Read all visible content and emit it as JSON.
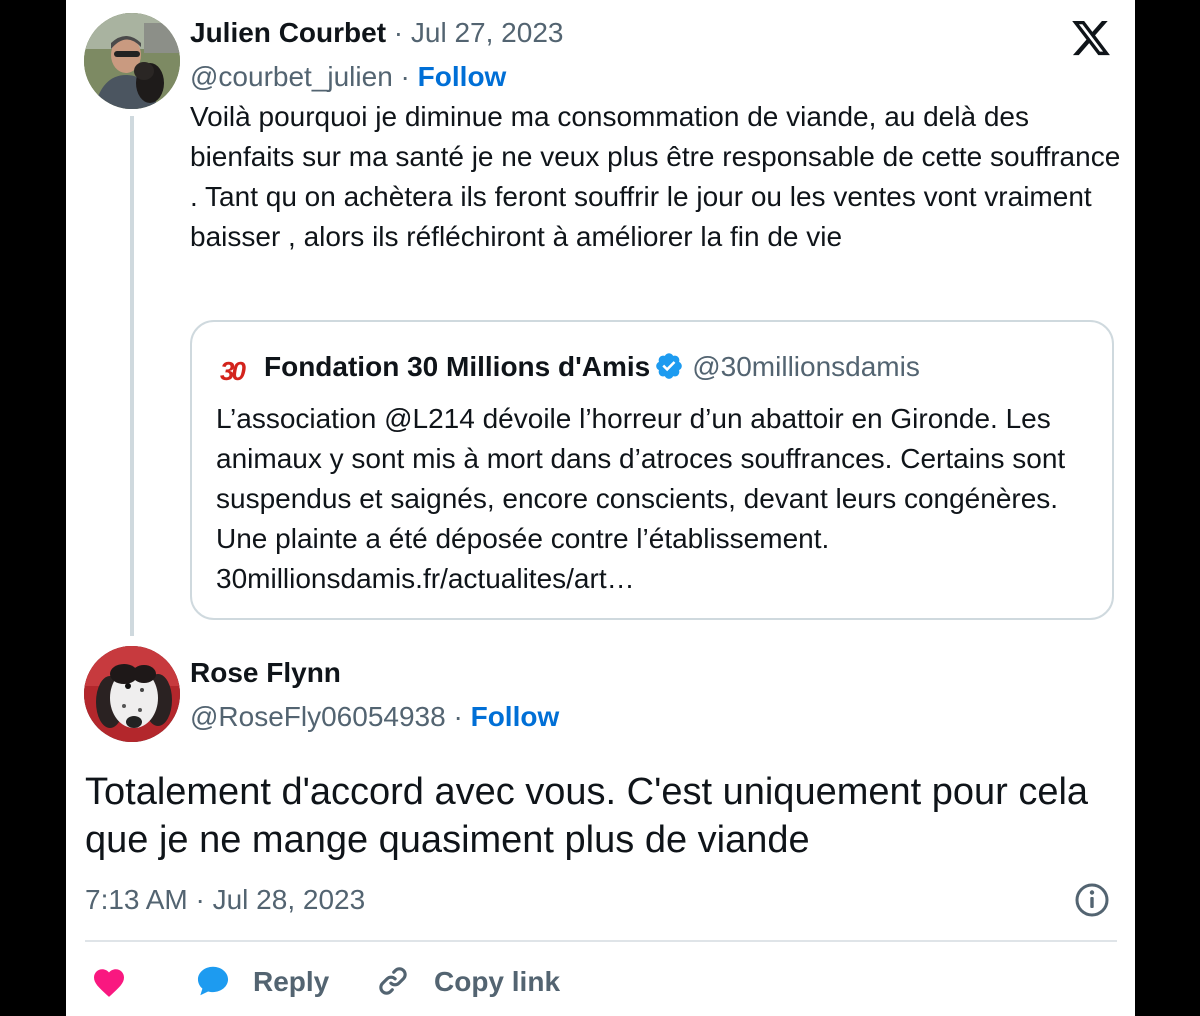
{
  "parent": {
    "author_name": "Julien Courbet",
    "separator": " · ",
    "date": "Jul 27, 2023",
    "handle": "@courbet_julien",
    "follow_label": "Follow",
    "text": "Voilà pourquoi je diminue ma consommation de viande, au delà des bienfaits sur ma santé je ne veux plus être responsable de cette souffrance . Tant qu on achètera ils feront souffrir le jour ou les ventes vont vraiment baisser , alors ils réfléchiront à améliorer la fin de vie"
  },
  "quote": {
    "logo_text": "30",
    "author_name": "Fondation 30 Millions d'Amis",
    "handle": "@30millionsdamis",
    "text": "L’association @L214 dévoile  l’horreur d’un abattoir en Gironde. Les animaux y sont mis à mort dans d’atroces souffrances. Certains sont suspendus et saignés, encore conscients, devant leurs congénères. Une plainte a été déposée contre l’établissement. 30millionsdamis.fr/actualites/art…"
  },
  "reply": {
    "author_name": "Rose Flynn",
    "handle": "@RoseFly06054938",
    "separator": " · ",
    "follow_label": "Follow",
    "text": "Totalement d'accord avec vous. C'est uniquement pour cela que je ne mange quasiment plus de viande",
    "timestamp": "7:13 AM · Jul 28, 2023"
  },
  "actions": {
    "like_icon": "heart-icon",
    "reply_label": "Reply",
    "copy_label": "Copy link"
  },
  "colors": {
    "link": "#006fd6",
    "muted": "#536471",
    "like": "#f91880",
    "reply_bubble": "#1d9bf0",
    "verified": "#1d9bf0",
    "brand_red": "#d3231c"
  }
}
